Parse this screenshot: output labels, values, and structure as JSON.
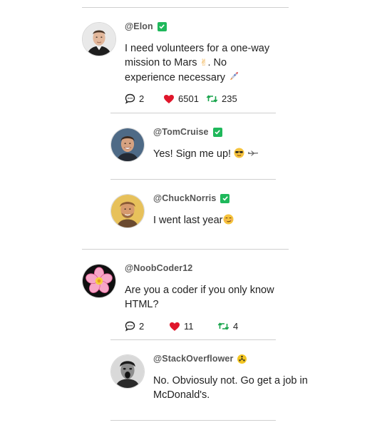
{
  "posts": [
    {
      "handle": "@Elon",
      "verified": true,
      "text": "I need volunteers for a one-way mission to Mars ✌️. No experience necessary 🚀",
      "text_parts": [
        "I need volunteers for a one-way",
        "mission to Mars",
        ". No",
        "experience necessary"
      ],
      "emoji": {
        "hand": "✌",
        "rocket": "↗"
      },
      "comments": "2",
      "likes": "6501",
      "retweets": "235",
      "replies": [
        {
          "handle": "@TomCruise",
          "verified": true,
          "text": "Yes! Sign me up!",
          "emoji": "😎 ✈"
        },
        {
          "handle": "@ChuckNorris",
          "verified": true,
          "text": "I went last year",
          "emoji": "😏"
        }
      ]
    },
    {
      "handle": "@NoobCoder12",
      "verified": false,
      "text_parts": [
        "Are you a coder if you only know",
        "HTML?"
      ],
      "comments": "2",
      "likes": "11",
      "retweets": "4",
      "replies": [
        {
          "handle": "@StackOverflower",
          "badge": "hazard",
          "text_parts": [
            "No. Obviosuly not. Go get a job in",
            "McDonald's."
          ]
        }
      ]
    }
  ],
  "colors": {
    "verified": "#1fb85b",
    "like": "#e0162b",
    "retweet": "#17a34a",
    "divider": "#cfcfcf"
  },
  "icons": [
    "comment-icon",
    "heart-icon",
    "retweet-icon",
    "verified-check-icon",
    "hazard-icon"
  ]
}
